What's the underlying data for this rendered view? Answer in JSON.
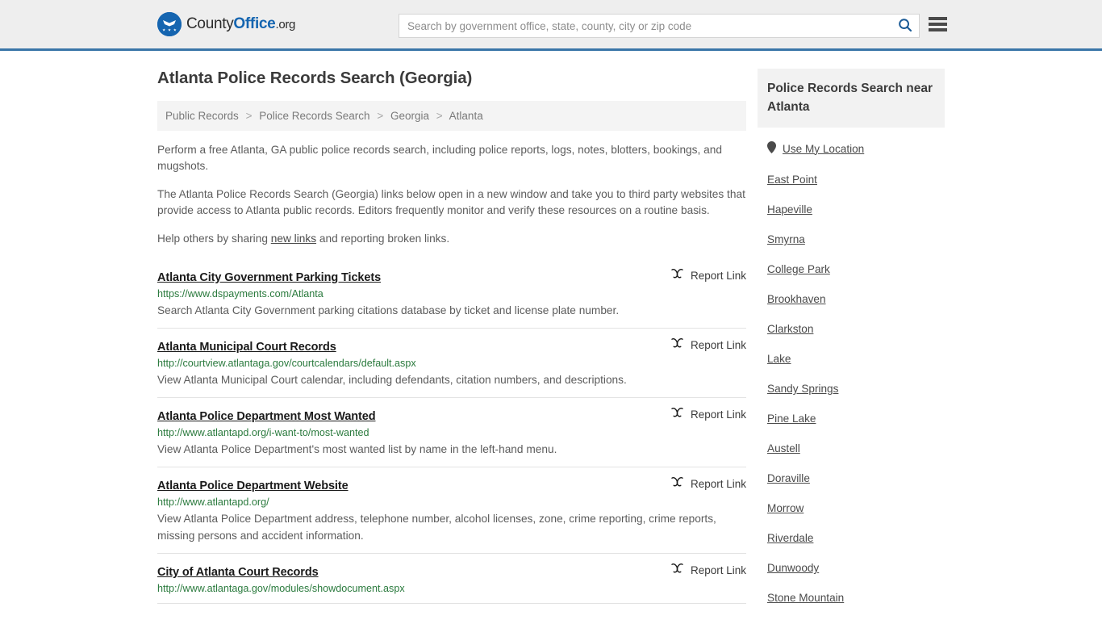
{
  "header": {
    "logo": {
      "icon": "eagle-shield-logo-icon",
      "text_part1": "County",
      "text_part2": "Office",
      "text_part3": ".org"
    },
    "search": {
      "placeholder": "Search by government office, state, county, city or zip code",
      "value": "",
      "button_icon": "search-icon"
    },
    "menu_icon": "hamburger-menu-icon",
    "accent_color": "#3a76a8",
    "background_color": "#eeeeee"
  },
  "main": {
    "title": "Atlanta Police Records Search (Georgia)",
    "breadcrumb": {
      "separator": ">",
      "items": [
        "Public Records",
        "Police Records Search",
        "Georgia",
        "Atlanta"
      ]
    },
    "intro": {
      "paragraph1": "Perform a free Atlanta, GA public police records search, including police reports, logs, notes, blotters, bookings, and mugshots.",
      "paragraph2": "The Atlanta Police Records Search (Georgia) links below open in a new window and take you to third party websites that provide access to Atlanta public records. Editors frequently monitor and verify these resources on a routine basis.",
      "paragraph3_before": "Help others by sharing ",
      "paragraph3_link": "new links",
      "paragraph3_after": " and reporting broken links."
    },
    "report_link_label": "Report Link",
    "report_link_icon": "broken-link-icon",
    "results": [
      {
        "title": "Atlanta City Government Parking Tickets",
        "url": "https://www.dspayments.com/Atlanta",
        "description": "Search Atlanta City Government parking citations database by ticket and license plate number."
      },
      {
        "title": "Atlanta Municipal Court Records",
        "url": "http://courtview.atlantaga.gov/courtcalendars/default.aspx",
        "description": "View Atlanta Municipal Court calendar, including defendants, citation numbers, and descriptions."
      },
      {
        "title": "Atlanta Police Department Most Wanted",
        "url": "http://www.atlantapd.org/i-want-to/most-wanted",
        "description": "View Atlanta Police Department's most wanted list by name in the left-hand menu."
      },
      {
        "title": "Atlanta Police Department Website",
        "url": "http://www.atlantapd.org/",
        "description": "View Atlanta Police Department address, telephone number, alcohol licenses, zone, crime reporting, crime reports, missing persons and accident information."
      },
      {
        "title": "City of Atlanta Court Records",
        "url": "http://www.atlantaga.gov/modules/showdocument.aspx",
        "description": ""
      }
    ]
  },
  "sidebar": {
    "heading": "Police Records Search near Atlanta",
    "locate": {
      "label": "Use My Location",
      "icon": "map-pin-icon"
    },
    "items": [
      "East Point",
      "Hapeville",
      "Smyrna",
      "College Park",
      "Brookhaven",
      "Clarkston",
      "Lake",
      "Sandy Springs",
      "Pine Lake",
      "Austell",
      "Doraville",
      "Morrow",
      "Riverdale",
      "Dunwoody",
      "Stone Mountain"
    ]
  },
  "colors": {
    "link_green": "#2a7a3d",
    "brand_blue": "#1565b0",
    "header_border": "#3a76a8",
    "text_gray": "#5c5c5c"
  }
}
